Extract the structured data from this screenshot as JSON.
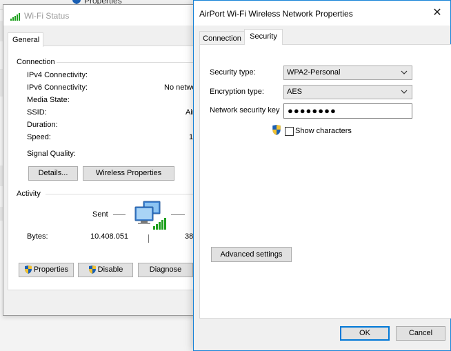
{
  "background_window": {
    "title": "Properties"
  },
  "wifi_status": {
    "title": "Wi-Fi Status",
    "tab": "General",
    "connection": {
      "heading": "Connection",
      "rows": [
        {
          "label": "IPv4 Connectivity:",
          "value": ""
        },
        {
          "label": "IPv6 Connectivity:",
          "value": "No netwo"
        },
        {
          "label": "Media State:",
          "value": ""
        },
        {
          "label": "SSID:",
          "value": "Air"
        },
        {
          "label": "Duration:",
          "value": ""
        },
        {
          "label": "Speed:",
          "value": "1"
        }
      ],
      "signal_quality_label": "Signal Quality:"
    },
    "buttons": {
      "details": "Details...",
      "wireless_properties": "Wireless Properties"
    },
    "activity": {
      "heading": "Activity",
      "sent_label": "Sent",
      "bytes_label": "Bytes:",
      "bytes_sent": "10.408.051",
      "bytes_received": "38"
    },
    "bottom_buttons": {
      "properties": "Properties",
      "disable": "Disable",
      "diagnose": "Diagnose"
    }
  },
  "properties_dialog": {
    "title": "AirPort Wi-Fi Wireless Network Properties",
    "close_glyph": "✕",
    "tabs": [
      {
        "label": "Connection"
      },
      {
        "label": "Security"
      }
    ],
    "active_tab": "Security",
    "security_type": {
      "label": "Security type:",
      "value": "WPA2-Personal"
    },
    "encryption_type": {
      "label": "Encryption type:",
      "value": "AES"
    },
    "network_key": {
      "label": "Network security key",
      "masked_value": "●●●●●●●●"
    },
    "show_characters": {
      "label": "Show characters",
      "checked": false
    },
    "advanced_settings": "Advanced settings",
    "ok": "OK",
    "cancel": "Cancel"
  },
  "colors": {
    "accent": "#0078d7",
    "signal_green": "#1ea01e",
    "shield_blue": "#1a5fb4",
    "shield_yellow": "#f2c12e"
  },
  "icons": [
    "wifi-signal-icon",
    "network-computer-icon",
    "uac-shield-icon",
    "chevron-down-icon",
    "close-icon"
  ]
}
